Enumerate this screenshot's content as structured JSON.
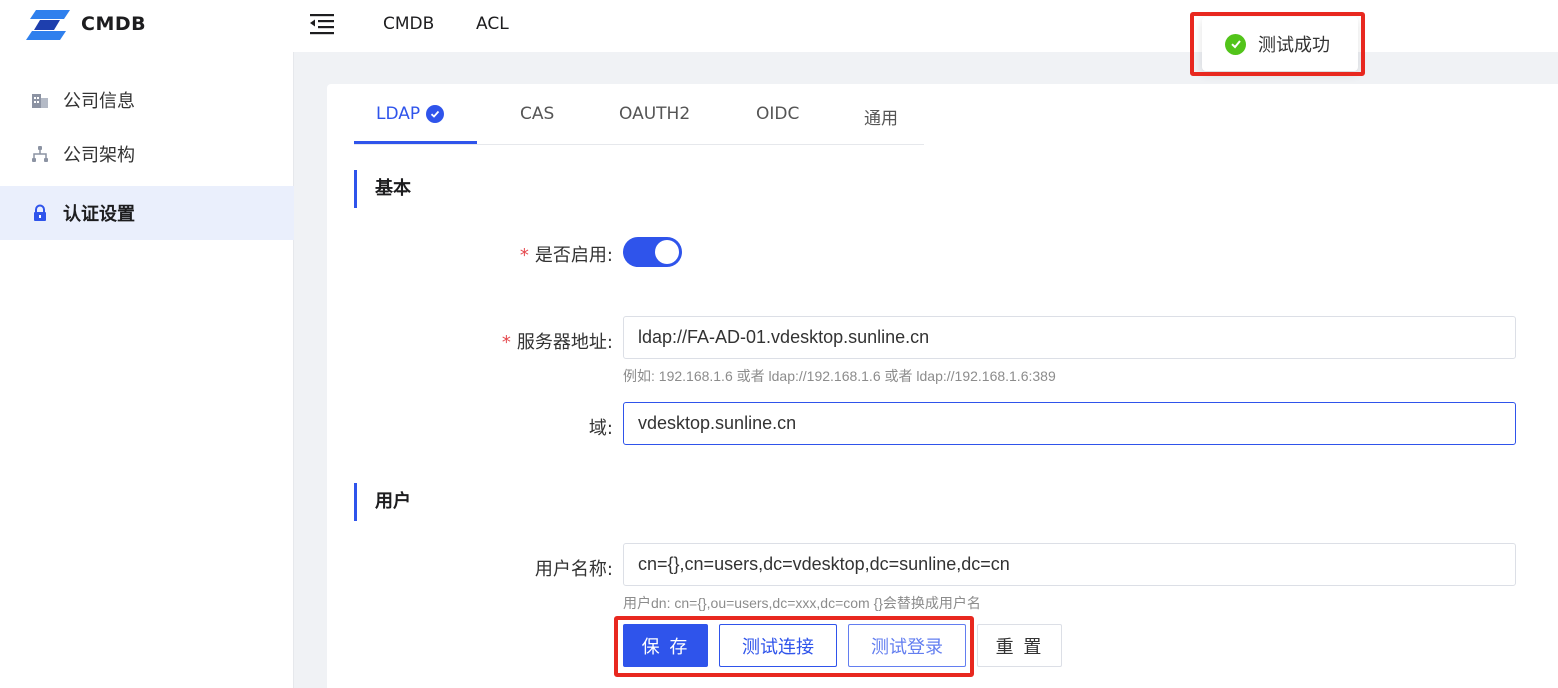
{
  "header": {
    "brand": "CMDB",
    "nav": [
      "CMDB",
      "ACL"
    ]
  },
  "sidebar": {
    "items": [
      {
        "label": "公司信息",
        "icon": "building-icon",
        "active": false
      },
      {
        "label": "公司架构",
        "icon": "org-structure-icon",
        "active": false
      },
      {
        "label": "认证设置",
        "icon": "lock-icon",
        "active": true
      }
    ]
  },
  "tabs": [
    {
      "label": "LDAP",
      "active": true,
      "verified": true
    },
    {
      "label": "CAS"
    },
    {
      "label": "OAUTH2"
    },
    {
      "label": "OIDC"
    },
    {
      "label": "通用"
    }
  ],
  "form": {
    "section_basic": "基本",
    "enabled_label": "是否启用:",
    "enabled": true,
    "server_label": "服务器地址:",
    "server_value": "ldap://FA-AD-01.vdesktop.sunline.cn",
    "server_hint": "例如: 192.168.1.6 或者 ldap://192.168.1.6 或者 ldap://192.168.1.6:389",
    "domain_label": "域:",
    "domain_value": "vdesktop.sunline.cn",
    "section_user": "用户",
    "username_label": "用户名称:",
    "username_value": "cn={},cn=users,dc=vdesktop,dc=sunline,dc=cn",
    "username_hint": "用户dn: cn={},ou=users,dc=xxx,dc=com {}会替换成用户名",
    "required_mark": "*"
  },
  "buttons": {
    "save": "保 存",
    "test_connect": "测试连接",
    "test_login": "测试登录",
    "reset": "重 置"
  },
  "toast": {
    "message": "测试成功",
    "type": "success"
  },
  "colors": {
    "primary": "#2f54eb",
    "success": "#52c41a",
    "highlight": "#e8281f",
    "required": "#e5484d"
  }
}
